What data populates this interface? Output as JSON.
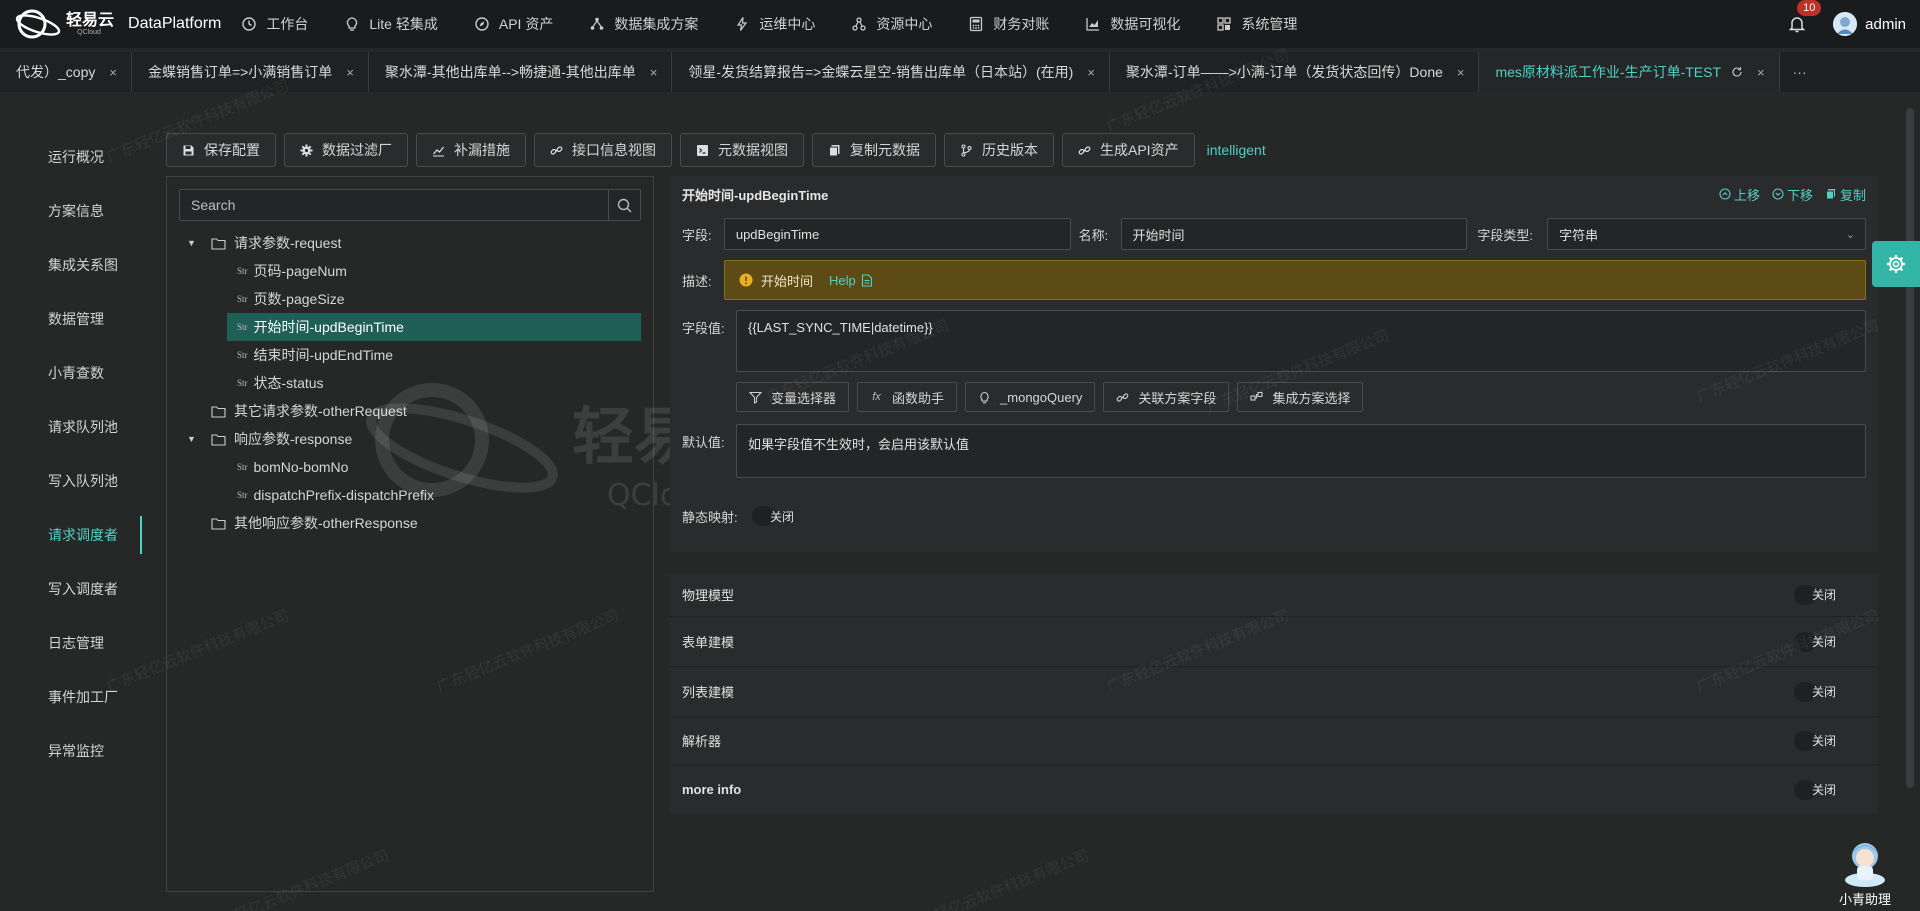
{
  "header": {
    "logo_text": "轻易云",
    "logo_sub": "QCloud",
    "brand": "DataPlatform",
    "menu": [
      {
        "label": "工作台",
        "icon": "clock-icon"
      },
      {
        "label": "Lite 轻集成",
        "icon": "bulb-icon"
      },
      {
        "label": "API 资产",
        "icon": "compass-icon"
      },
      {
        "label": "数据集成方案",
        "icon": "share-icon"
      },
      {
        "label": "运维中心",
        "icon": "lightning-icon"
      },
      {
        "label": "资源中心",
        "icon": "cluster-icon"
      },
      {
        "label": "财务对账",
        "icon": "calculator-icon"
      },
      {
        "label": "数据可视化",
        "icon": "chart-icon"
      },
      {
        "label": "系统管理",
        "icon": "grid-icon"
      }
    ],
    "notifications": "10",
    "user": "admin"
  },
  "tabs": [
    {
      "label": "代发）_copy",
      "close": "×"
    },
    {
      "label": "金蝶销售订单=>小满销售订单",
      "close": "×"
    },
    {
      "label": "聚水潭-其他出库单-->畅捷通-其他出库单",
      "close": "×"
    },
    {
      "label": "领星-发货结算报告=>金蝶云星空-销售出库单（日本站）(在用)",
      "close": "×"
    },
    {
      "label": "聚水潭-订单——>小满-订单（发货状态回传）Done",
      "close": "×"
    },
    {
      "label": "mes原材料派工作业-生产订单-TEST",
      "close": "×"
    }
  ],
  "tab_more": "···",
  "sidebar": {
    "items": [
      {
        "label": "运行概况"
      },
      {
        "label": "方案信息"
      },
      {
        "label": "集成关系图"
      },
      {
        "label": "数据管理"
      },
      {
        "label": "小青查数"
      },
      {
        "label": "请求队列池"
      },
      {
        "label": "写入队列池"
      },
      {
        "label": "请求调度者"
      },
      {
        "label": "写入调度者"
      },
      {
        "label": "日志管理"
      },
      {
        "label": "事件加工厂"
      },
      {
        "label": "异常监控"
      }
    ],
    "active_index": 7
  },
  "toolbar": {
    "buttons": [
      {
        "label": "保存配置",
        "icon": "save-icon"
      },
      {
        "label": "数据过滤厂",
        "icon": "gear-icon"
      },
      {
        "label": "补漏措施",
        "icon": "line-chart-icon"
      },
      {
        "label": "接口信息视图",
        "icon": "link-icon"
      },
      {
        "label": "元数据视图",
        "icon": "code-icon"
      },
      {
        "label": "复制元数据",
        "icon": "copy-icon"
      },
      {
        "label": "历史版本",
        "icon": "branch-icon"
      },
      {
        "label": "生成API资产",
        "icon": "link-icon"
      }
    ],
    "extra": "intelligent"
  },
  "tree": {
    "search_placeholder": "Search",
    "str_tag": "Str",
    "nodes": [
      {
        "label": "请求参数-request",
        "kind": "folder",
        "expanded": true
      },
      {
        "label": "页码-pageNum",
        "kind": "str"
      },
      {
        "label": "页数-pageSize",
        "kind": "str"
      },
      {
        "label": "开始时间-updBeginTime",
        "kind": "str",
        "selected": true
      },
      {
        "label": "结束时间-updEndTime",
        "kind": "str"
      },
      {
        "label": "状态-status",
        "kind": "str"
      },
      {
        "label": "其它请求参数-otherRequest",
        "kind": "folder"
      },
      {
        "label": "响应参数-response",
        "kind": "folder",
        "expanded": true
      },
      {
        "label": "bomNo-bomNo",
        "kind": "str"
      },
      {
        "label": "dispatchPrefix-dispatchPrefix",
        "kind": "str"
      },
      {
        "label": "其他响应参数-otherResponse",
        "kind": "folder"
      }
    ]
  },
  "detail": {
    "title": "开始时间-updBeginTime",
    "actions": {
      "up": "上移",
      "down": "下移",
      "copy": "复制"
    },
    "field_label": "字段:",
    "field_value": "updBeginTime",
    "name_label": "名称:",
    "name_value": "开始时间",
    "type_label": "字段类型:",
    "type_value": "字符串",
    "desc_label": "描述:",
    "desc_value": "开始时间",
    "help": "Help",
    "value_label": "字段值:",
    "value_text": "{{LAST_SYNC_TIME|datetime}}",
    "sub_buttons": [
      {
        "label": "变量选择器",
        "icon": "filter-icon"
      },
      {
        "label": "函数助手",
        "icon": "fx-icon"
      },
      {
        "label": "_mongoQuery",
        "icon": "bulb-icon"
      },
      {
        "label": "关联方案字段",
        "icon": "link-icon"
      },
      {
        "label": "集成方案选择",
        "icon": "nodes-icon"
      }
    ],
    "default_label": "默认值:",
    "default_placeholder": "如果字段值不生效时，会启用该默认值",
    "static_label": "静态映射:",
    "static_toggle": "关闭"
  },
  "sections": [
    {
      "label": "物理模型",
      "toggle": "关闭"
    },
    {
      "label": "表单建模",
      "toggle": "关闭"
    },
    {
      "label": "列表建模",
      "toggle": "关闭"
    },
    {
      "label": "解析器",
      "toggle": "关闭"
    },
    {
      "label": "more info",
      "toggle": "关闭"
    }
  ],
  "assistant": {
    "label": "小青助理"
  },
  "watermark": "广东轻亿云软件科技有限公司",
  "big_watermark": {
    "cn": "轻易云",
    "en": "QCloud"
  },
  "colors": {
    "accent": "#4fd1c5",
    "selected_bg": "#1f5f58",
    "desc_bg": "#5c4b14",
    "badge": "#c0302a"
  }
}
